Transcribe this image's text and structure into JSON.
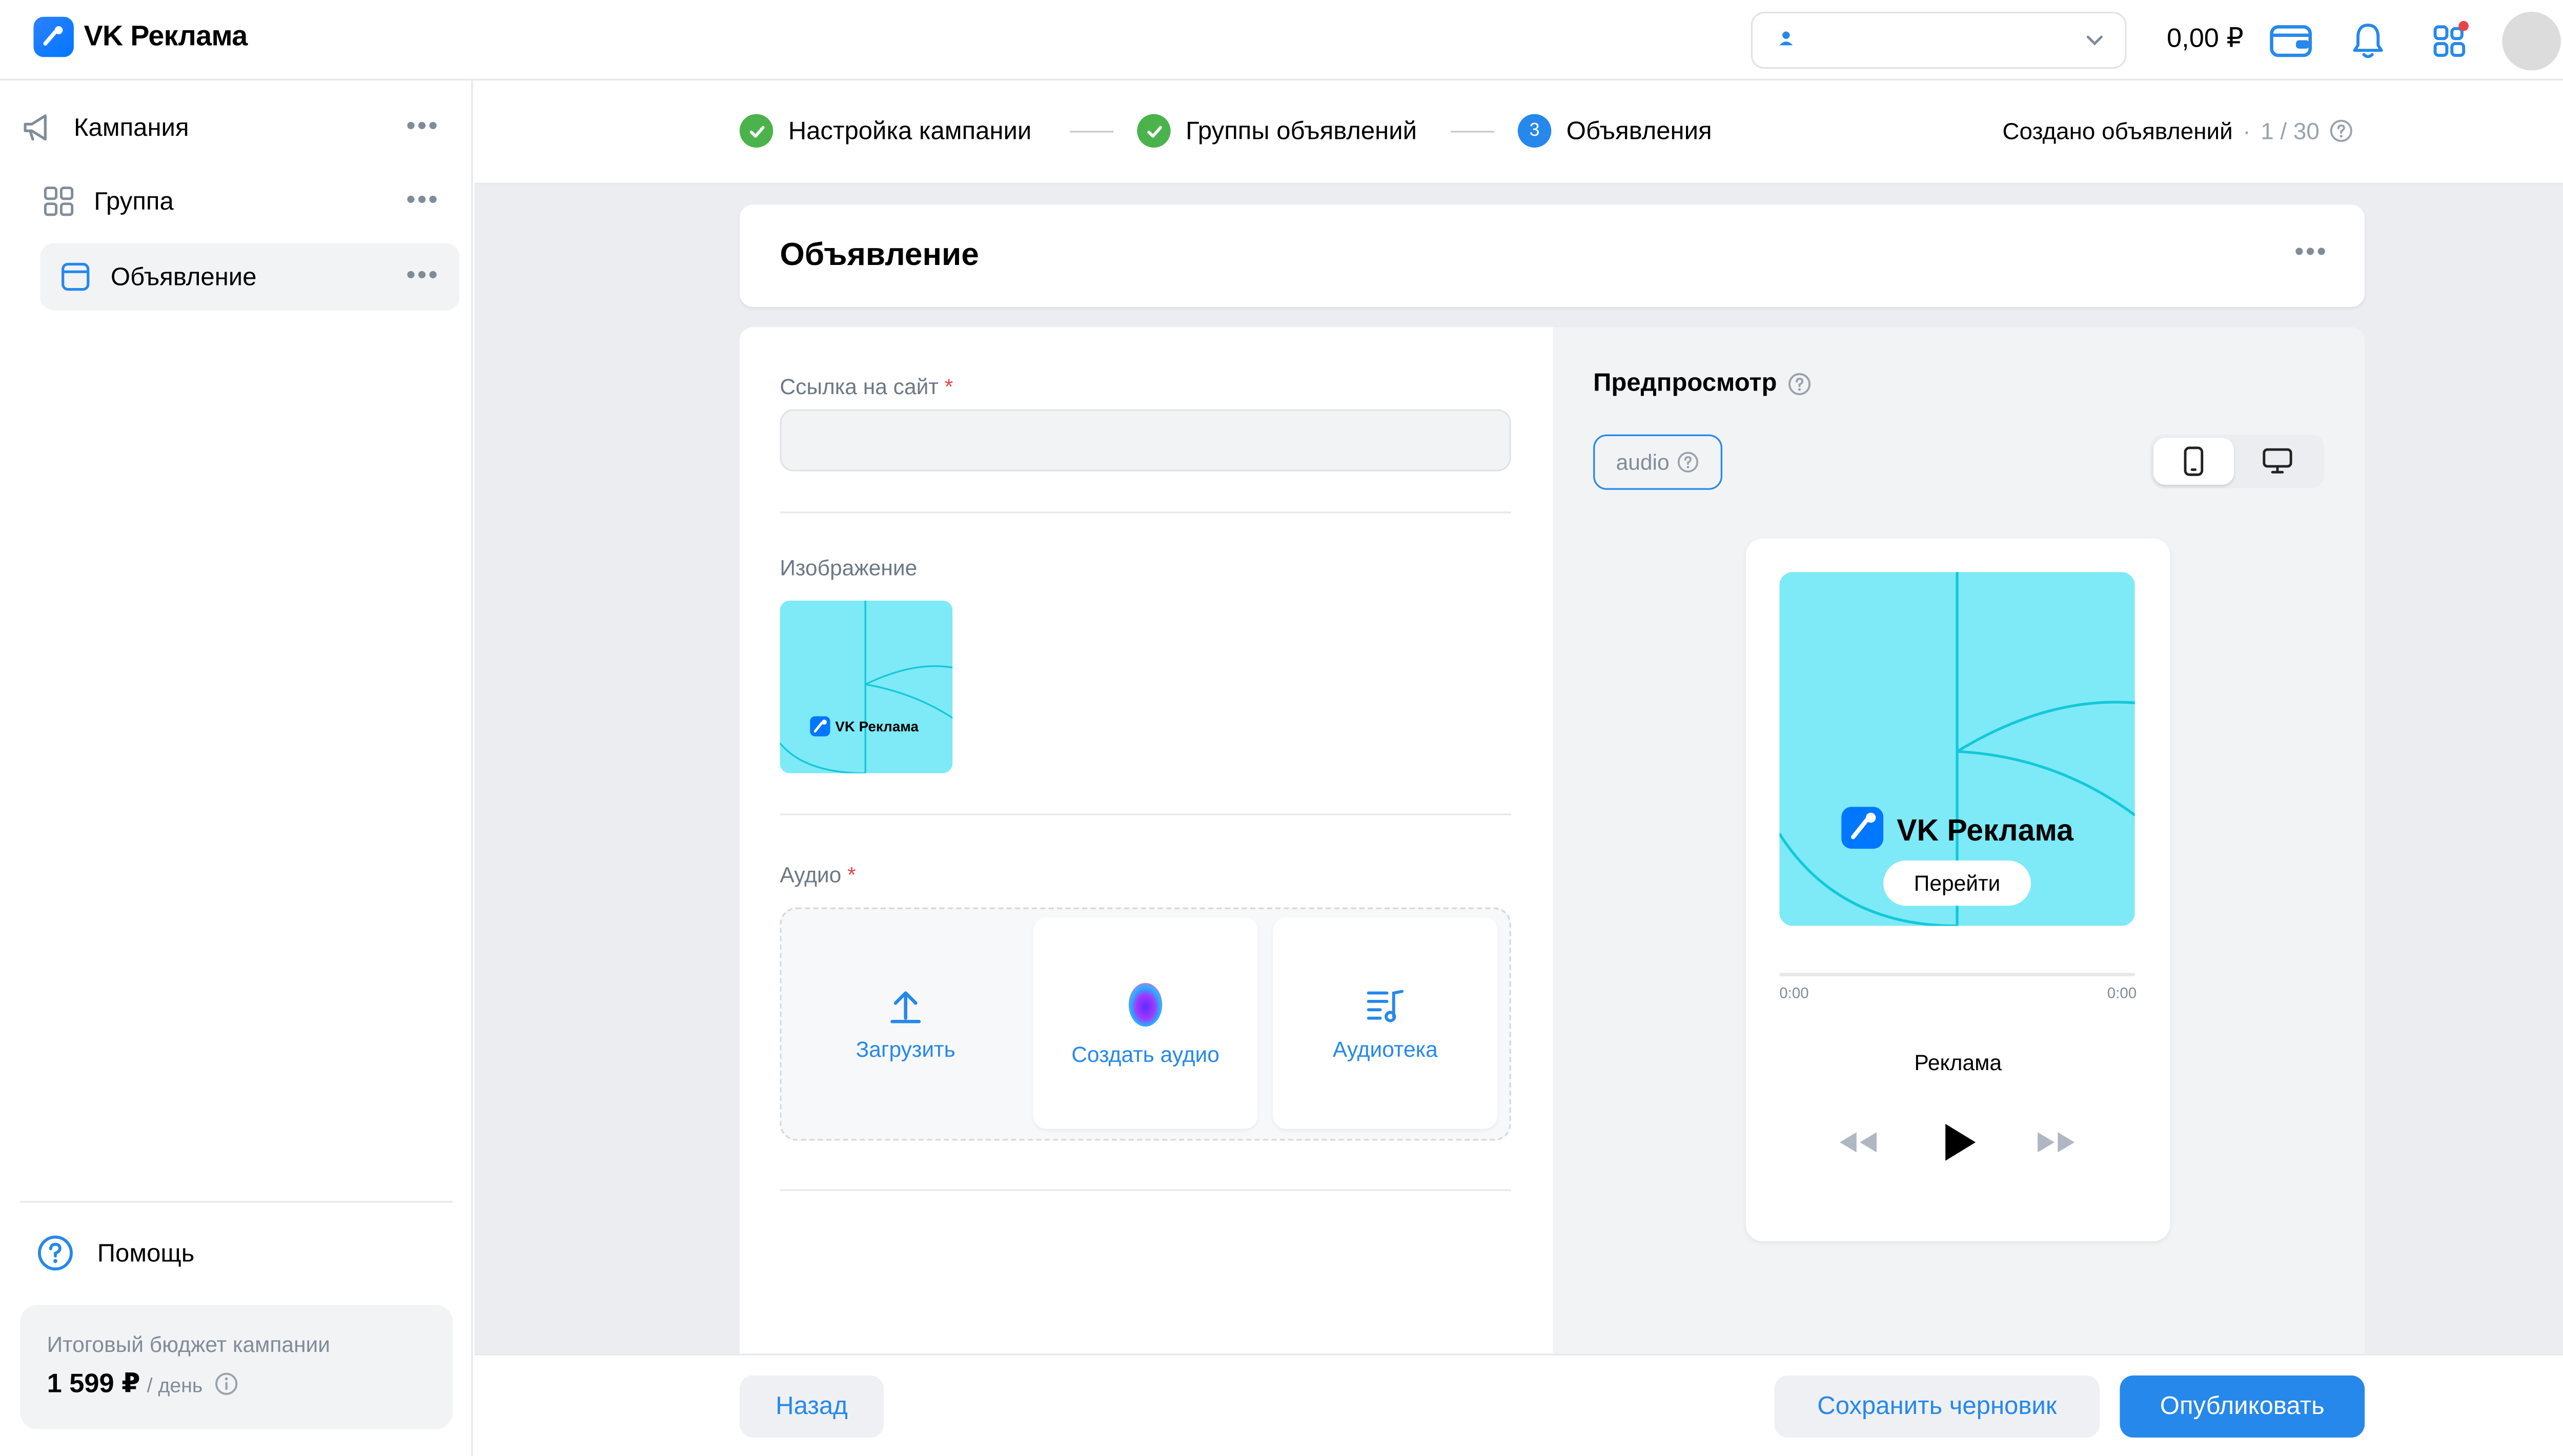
{
  "header": {
    "brand": "VK Реклама",
    "balance": "0,00 ₽",
    "icons": [
      "wallet-icon",
      "bell-icon",
      "apps-icon",
      "avatar",
      "chevron-down-icon"
    ],
    "notification_dot_color": "#e64646"
  },
  "sidebar": {
    "items": [
      {
        "label": "Кампания",
        "icon": "megaphone-icon",
        "more": "•••"
      },
      {
        "label": "Группа",
        "icon": "grid-icon",
        "more": "•••"
      },
      {
        "label": "Объявление",
        "icon": "ad-icon",
        "more": "•••",
        "active": true
      }
    ],
    "help_label": "Помощь",
    "budget": {
      "label": "Итоговый бюджет кампании",
      "amount": "1 599 ₽",
      "unit": "/ день"
    }
  },
  "stepper": {
    "steps": [
      {
        "label": "Настройка кампании",
        "state": "done"
      },
      {
        "label": "Группы объявлений",
        "state": "done"
      },
      {
        "label": "Объявления",
        "state": "current",
        "number": "3"
      }
    ],
    "created_label": "Создано объявлений",
    "created_sep": "·",
    "created_count": "1 / 30"
  },
  "ad": {
    "title": "Объявление",
    "more": "•••"
  },
  "form": {
    "link_label": "Ссылка на сайт",
    "link_value": "",
    "required_mark": "*",
    "image_label": "Изображение",
    "audio_label": "Аудио",
    "audio_options": {
      "upload": "Загрузить",
      "create": "Создать аудио",
      "library": "Аудиотека"
    }
  },
  "preview": {
    "title": "Предпросмотр",
    "format": "audio",
    "brand": "VK Реклама",
    "cta": "Перейти",
    "time_start": "0:00",
    "time_end": "0:00",
    "track_title": "Реклама",
    "playback_progress": 0
  },
  "footer": {
    "back": "Назад",
    "save_draft": "Сохранить черновик",
    "publish": "Опубликовать"
  },
  "colors": {
    "accent": "#2688eb",
    "success": "#4bb34b",
    "creative_bg": "#7ee9f7",
    "creative_line": "#12c8d8"
  }
}
